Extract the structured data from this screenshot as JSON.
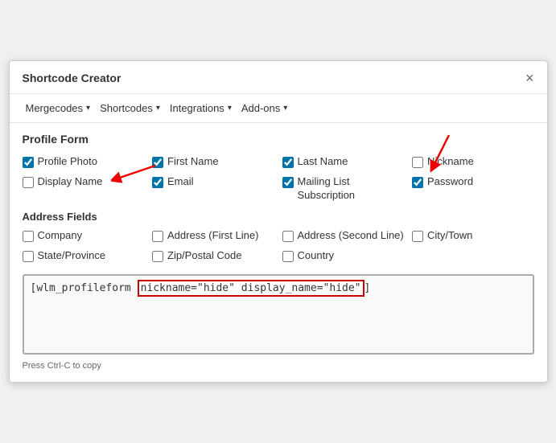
{
  "dialog": {
    "title": "Shortcode Creator",
    "close_label": "×"
  },
  "toolbar": {
    "items": [
      {
        "label": "Mergecodes",
        "id": "mergecodes"
      },
      {
        "label": "Shortcodes",
        "id": "shortcodes"
      },
      {
        "label": "Integrations",
        "id": "integrations"
      },
      {
        "label": "Add-ons",
        "id": "addons"
      }
    ]
  },
  "form": {
    "section_title": "Profile Form",
    "fields": [
      {
        "label": "Profile Photo",
        "checked": true,
        "id": "profile_photo"
      },
      {
        "label": "First Name",
        "checked": true,
        "id": "first_name"
      },
      {
        "label": "Last Name",
        "checked": true,
        "id": "last_name"
      },
      {
        "label": "Nickname",
        "checked": false,
        "id": "nickname"
      },
      {
        "label": "Display Name",
        "checked": false,
        "id": "display_name"
      },
      {
        "label": "Email",
        "checked": true,
        "id": "email"
      },
      {
        "label": "Mailing List Subscription",
        "checked": true,
        "id": "mailing_list"
      },
      {
        "label": "Password",
        "checked": true,
        "id": "password"
      }
    ],
    "address_section_title": "Address Fields",
    "address_fields": [
      {
        "label": "Company",
        "checked": false,
        "id": "company"
      },
      {
        "label": "Address (First Line)",
        "checked": false,
        "id": "address1"
      },
      {
        "label": "Address (Second Line)",
        "checked": false,
        "id": "address2"
      },
      {
        "label": "City/Town",
        "checked": false,
        "id": "city"
      },
      {
        "label": "State/Province",
        "checked": false,
        "id": "state"
      },
      {
        "label": "Zip/Postal Code",
        "checked": false,
        "id": "zip"
      },
      {
        "label": "Country",
        "checked": false,
        "id": "country"
      }
    ]
  },
  "output": {
    "shortcode_prefix": "[wlm_profileform ",
    "shortcode_params": "nickname=\"hide\" display_name=\"hide\"",
    "shortcode_suffix": "]",
    "hint": "Press Ctrl-C to copy"
  }
}
